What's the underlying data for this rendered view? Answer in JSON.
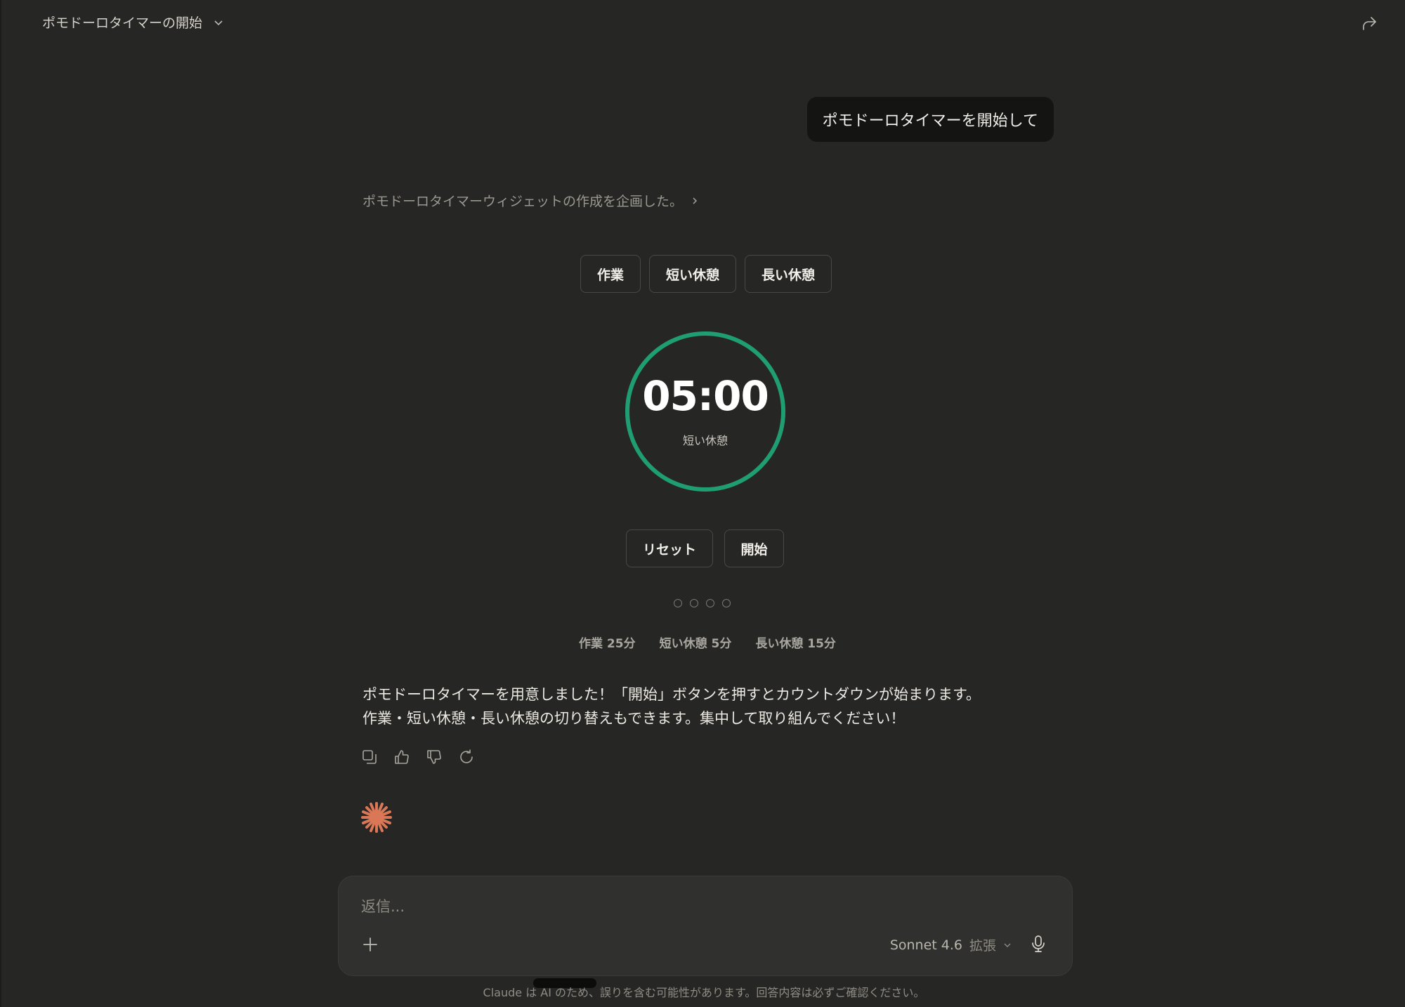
{
  "header": {
    "title": "ポモドーロタイマーの開始"
  },
  "user_message": "ポモドーロタイマーを開始して",
  "thinking_summary": "ポモドーロタイマーウィジェットの作成を企画した。",
  "widget": {
    "tabs": [
      {
        "label": "作業"
      },
      {
        "label": "短い休憩"
      },
      {
        "label": "長い休憩"
      }
    ],
    "time": "05:00",
    "mode": "短い休憩",
    "ring_color": "#1f9e73",
    "ring_progress": 1.0,
    "reset_label": "リセット",
    "start_label": "開始",
    "session_dots": 4,
    "durations": [
      {
        "text": "作業 25分"
      },
      {
        "text": "短い休憩 5分"
      },
      {
        "text": "長い休憩 15分"
      }
    ]
  },
  "response": {
    "line1": "ポモドーロタイマーを用意しました！「開始」ボタンを押すとカウントダウンが始まります。",
    "line2": "作業・短い休憩・長い休憩の切り替えもできます。集中して取り組んでください！"
  },
  "action_icons": [
    "copy-icon",
    "thumbs-up-icon",
    "thumbs-down-icon",
    "retry-icon"
  ],
  "composer": {
    "placeholder": "返信...",
    "model": "Sonnet 4.6",
    "model_mode": "拡張"
  },
  "disclaimer": "Claude は AI のため、誤りを含む可能性があります。回答内容は必ずご確認ください。",
  "colors": {
    "background": "#262624",
    "accent_spark": "#d97757",
    "ring": "#1f9e73"
  }
}
